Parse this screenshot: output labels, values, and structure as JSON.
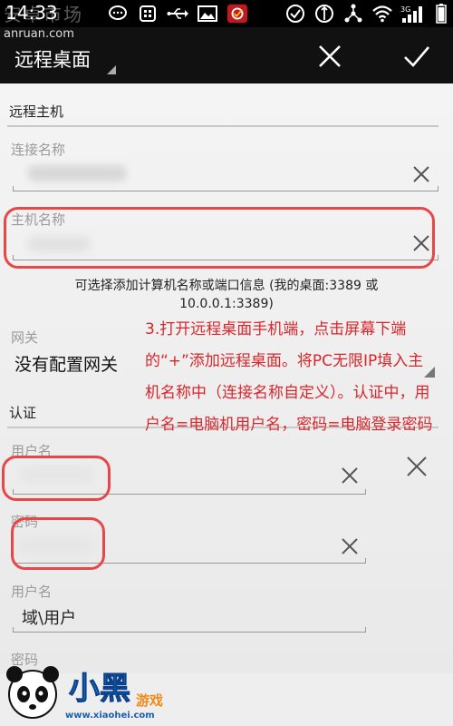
{
  "status_bar": {
    "time": "14:33",
    "watermark": "安卓市场",
    "network_label": "3G"
  },
  "action_bar": {
    "subtitle_watermark": "anruan.com",
    "title": "远程桌面",
    "cancel_icon": "close-icon",
    "ok_icon": "checkmark-icon"
  },
  "sections": {
    "remote_host": "远程主机",
    "gateway": "网关",
    "auth": "认证"
  },
  "fields": {
    "connection_name_label": "连接名称",
    "host_name_label": "主机名称",
    "host_hint": "可选择添加计算机名称或端口信息 (我的桌面:3389 或 10.0.0.1:3389)",
    "gateway_value": "没有配置网关",
    "username_label": "用户名",
    "password_label": "密码",
    "username2_label": "用户名",
    "username2_placeholder": "域\\用户",
    "password2_label": "密码"
  },
  "annotation": "3.打开远程桌面手机端，点击屏幕下端的“+”添加远程桌面。将PC无限IP填入主机名称中（连接名称自定义）。认证中，用户名=电脑机用户名，密码=电脑登录密码",
  "logo": {
    "brand_big": "小黑",
    "brand_small": "游戏",
    "site": "www.xiaohei.com"
  },
  "colors": {
    "annotation_red": "#d8262b",
    "oval_red": "#e8474a",
    "logo_blue": "#1d8ad6"
  }
}
